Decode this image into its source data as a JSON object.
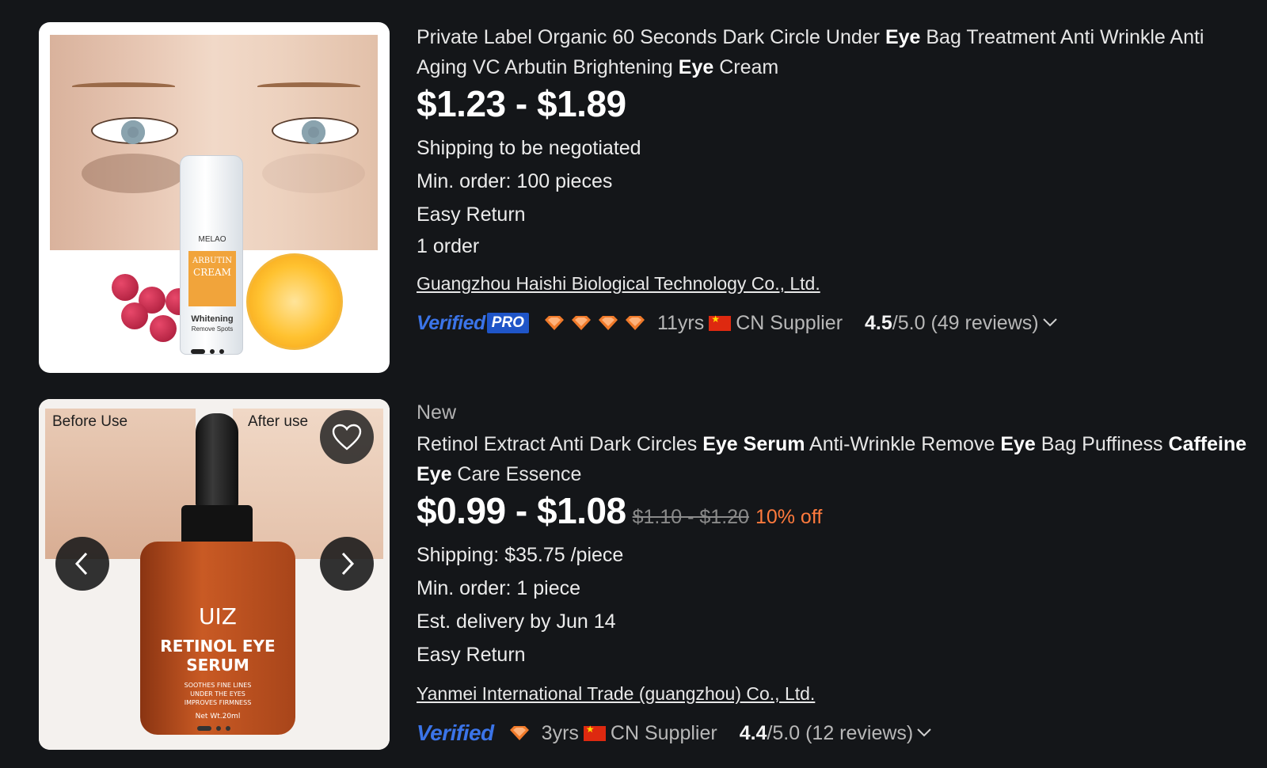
{
  "listings": [
    {
      "title_parts": [
        {
          "text": "Private Label Organic 60 Seconds Dark Circle Under ",
          "bold": false
        },
        {
          "text": "Eye",
          "bold": true
        },
        {
          "text": " Bag Treatment Anti Wrinkle Anti Aging VC Arbutin Brightening ",
          "bold": false
        },
        {
          "text": "Eye",
          "bold": true
        },
        {
          "text": " Cream",
          "bold": false
        }
      ],
      "price": "$1.23 - $1.89",
      "shipping": "Shipping to be negotiated",
      "min_order": "Min. order: 100 pieces",
      "easy_return": "Easy Return",
      "orders": "1 order",
      "supplier": "Guangzhou Haishi Biological Technology Co., Ltd.",
      "verified": "Verified",
      "pro": "PRO",
      "diamond_count": 4,
      "years": "11yrs",
      "supplier_type": "CN Supplier",
      "rating_value": "4.5",
      "rating_rest": "/5.0 (49 reviews)",
      "image_text": {
        "brand": "MELAO",
        "label_line1": "ARBUTIN",
        "label_line2": "CREAM",
        "label_line3": "Whitening",
        "label_line4": "Remove Spots"
      }
    },
    {
      "badge": "New",
      "title_parts": [
        {
          "text": "Retinol Extract Anti Dark Circles ",
          "bold": false
        },
        {
          "text": "Eye Serum",
          "bold": true
        },
        {
          "text": " Anti-Wrinkle Remove ",
          "bold": false
        },
        {
          "text": "Eye",
          "bold": true
        },
        {
          "text": " Bag Puffiness ",
          "bold": false
        },
        {
          "text": "Caffeine Eye",
          "bold": true
        },
        {
          "text": " Care Essence",
          "bold": false
        }
      ],
      "price": "$0.99 - $1.08",
      "old_price": "$1.10 - $1.20",
      "discount": "10% off",
      "shipping": "Shipping: $35.75 /piece",
      "min_order": "Min. order: 1 piece",
      "delivery": "Est. delivery by Jun 14",
      "easy_return": "Easy Return",
      "supplier": "Yanmei International Trade (guangzhou) Co., Ltd.",
      "verified": "Verified",
      "diamond_count": 1,
      "years": "3yrs",
      "supplier_type": "CN Supplier",
      "rating_value": "4.4",
      "rating_rest": "/5.0 (12 reviews)",
      "image_text": {
        "before": "Before Use",
        "after": "After use",
        "brand": "UIZ",
        "product_line1": "RETINOL EYE",
        "product_line2": "SERUM",
        "small_text": "SOOTHES FINE LINES UNDER THE EYES IMPROVES FIRMNESS",
        "net": "Net Wt.20ml"
      }
    }
  ],
  "colors": {
    "background": "#141619",
    "discount": "#ff7a3d",
    "verified": "#3b74e8",
    "diamond": "#f07a2a"
  },
  "icons": {
    "wishlist": "heart-icon",
    "prev": "chevron-left-icon",
    "next": "chevron-right-icon",
    "rating_expand": "chevron-down-icon",
    "supplier_level": "diamond-icon",
    "country": "cn-flag-icon"
  }
}
